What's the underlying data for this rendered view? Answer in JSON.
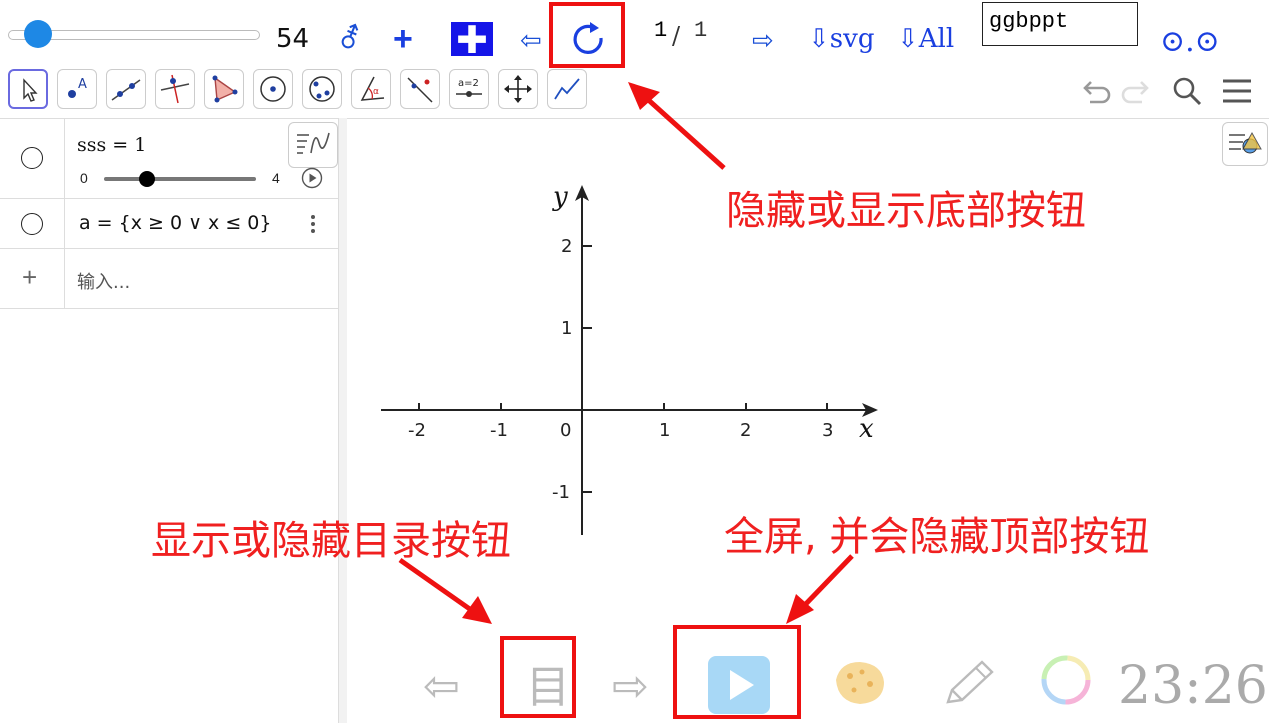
{
  "toolbar": {
    "slider_value": "54",
    "gender_icon": "⚦",
    "plus_icon": "+",
    "plus_box_icon": "✚",
    "prev_arrow": "⇦",
    "refresh_icon": "refresh-icon",
    "page_current": "1",
    "page_sep": "/",
    "page_total": "1",
    "next_arrow": "⇨",
    "svg_label": "⇩svg",
    "all_label": "⇩All",
    "name_input": "ggbppt",
    "dots_label": "⊙.⊙"
  },
  "algebra": {
    "row1_text": "sss = 1",
    "row1_min": "0",
    "row1_max": "4",
    "row1_value": 1,
    "row2_text": "a = {x ≥ 0 ∨ x ≤ 0}",
    "input_placeholder": "输入..."
  },
  "graph": {
    "x_label": "x",
    "y_label": "y",
    "x_ticks": [
      "-2",
      "-1",
      "0",
      "1",
      "2",
      "3"
    ],
    "y_ticks": [
      "2",
      "1",
      "-1"
    ]
  },
  "bottom": {
    "prev": "⇦",
    "menu": "目",
    "next": "⇨",
    "clock": "23:26"
  },
  "annotations": {
    "top_callout": "隐藏或显示底部按钮",
    "left_callout": "显示或隐藏目录按钮",
    "right_callout": "全屏, 并会隐藏顶部按钮"
  },
  "colors": {
    "accent_blue": "#1a3fe0",
    "annotation_red": "#ee1111",
    "slider_blue": "#1e88e5"
  }
}
